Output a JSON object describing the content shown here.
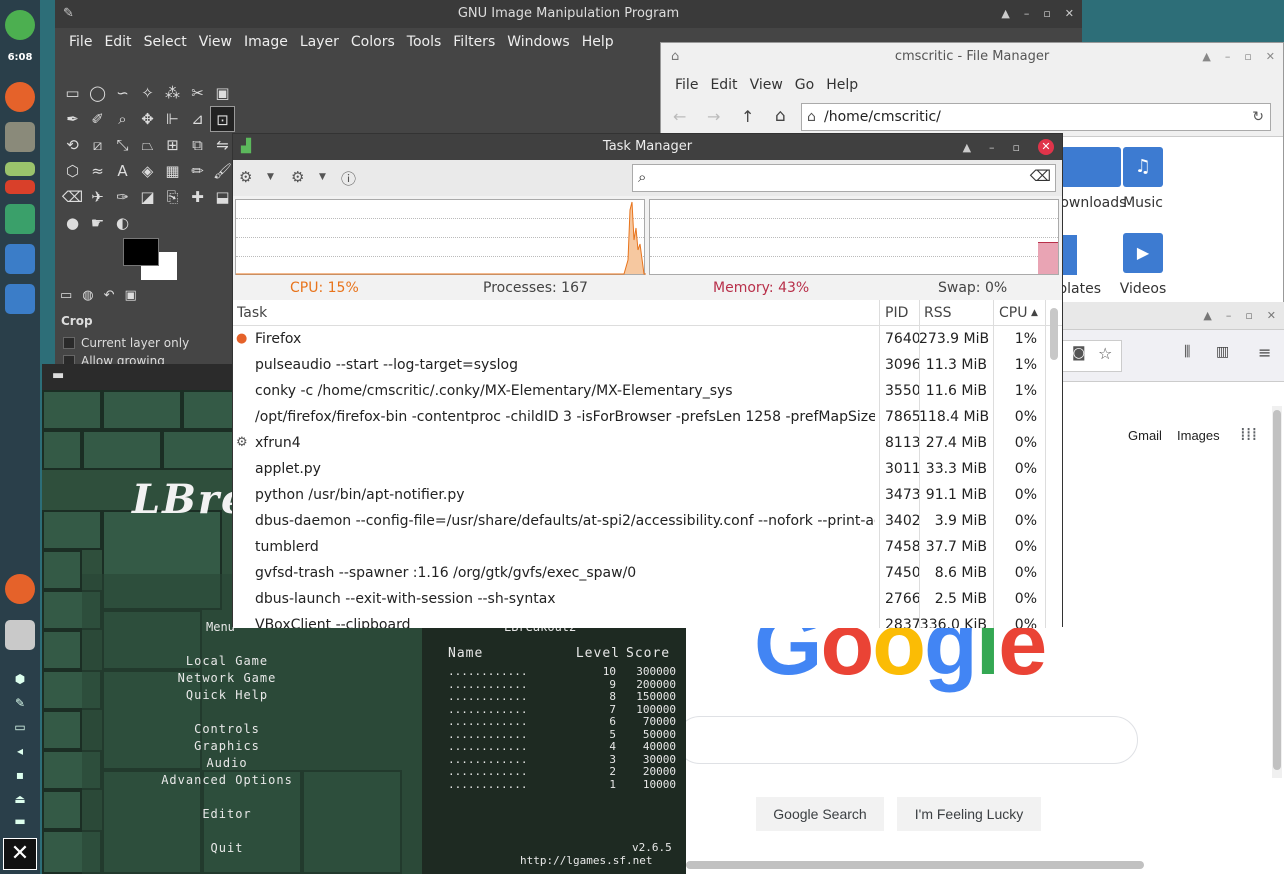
{
  "panel": {
    "time": "6:08",
    "icons": [
      "power-icon",
      "firefox-icon",
      "gimp-icon",
      "pen-icon",
      "lbreakout-icon",
      "taskmanager-icon",
      "home-folder-icon",
      "home-folder-icon",
      "firefox-icon",
      "files-icon"
    ],
    "tray": [
      "package-icon",
      "paperclip-icon",
      "display-icon",
      "volume-icon",
      "lock-icon",
      "eject-icon",
      "keyboard-icon"
    ]
  },
  "gimp": {
    "title": "GNU Image Manipulation Program",
    "menu": [
      "File",
      "Edit",
      "Select",
      "View",
      "Image",
      "Layer",
      "Colors",
      "Tools",
      "Filters",
      "Windows",
      "Help"
    ],
    "tool_options_title": "Crop",
    "current_layer_only": "Current layer only",
    "allow_growing": "Allow growing"
  },
  "lbreakout": {
    "logo": "LBreakout",
    "menu_title": "Menu",
    "menu": [
      "Local Game",
      "Network Game",
      "Quick Help",
      "",
      "Controls",
      "Graphics",
      "Audio",
      "Advanced Options",
      "",
      "Editor",
      "",
      "Quit"
    ],
    "highscore_title": "LBreakout2",
    "headers": [
      "Name",
      "Level",
      "Score"
    ],
    "scores": [
      [
        "............",
        "10",
        "300000"
      ],
      [
        "............",
        "9",
        "200000"
      ],
      [
        "............",
        "8",
        "150000"
      ],
      [
        "............",
        "7",
        "100000"
      ],
      [
        "............",
        "6",
        "70000"
      ],
      [
        "............",
        "5",
        "50000"
      ],
      [
        "............",
        "4",
        "40000"
      ],
      [
        "............",
        "3",
        "30000"
      ],
      [
        "............",
        "2",
        "20000"
      ],
      [
        "............",
        "1",
        "10000"
      ]
    ],
    "version": "v2.6.5",
    "url": "http://lgames.sf.net"
  },
  "filemanager": {
    "title": "cmscritic - File Manager",
    "menu": [
      "File",
      "Edit",
      "View",
      "Go",
      "Help"
    ],
    "path": "/home/cmscritic/",
    "folders": [
      "Downloads",
      "Music",
      "Templates",
      "Videos"
    ]
  },
  "firefox": {
    "links": [
      "Gmail",
      "Images"
    ],
    "search_button": "Google Search",
    "lucky_button": "I'm Feeling Lucky",
    "logo": "Google",
    "logo_colors": [
      "#4285F4",
      "#EA4335",
      "#FBBC05",
      "#4285F4",
      "#34A853",
      "#EA4335"
    ]
  },
  "taskmanager": {
    "title": "Task Manager",
    "search_value": "",
    "cpu_label": "CPU: 15%",
    "processes_label": "Processes: 167",
    "memory_label": "Memory: 43%",
    "swap_label": "Swap: 0%",
    "cpu_color": "#e8741c",
    "memory_color": "#b8304a",
    "columns": [
      "Task",
      "PID",
      "RSS",
      "CPU"
    ],
    "rows": [
      {
        "task": "Firefox",
        "pid": "7640",
        "rss": "273.9 MiB",
        "cpu": "1%",
        "icon": "firefox-icon"
      },
      {
        "task": "pulseaudio --start --log-target=syslog",
        "pid": "3096",
        "rss": "11.3 MiB",
        "cpu": "1%",
        "icon": ""
      },
      {
        "task": "conky -c /home/cmscritic/.conky/MX-Elementary/MX-Elementary_sys",
        "pid": "3550",
        "rss": "11.6 MiB",
        "cpu": "1%",
        "icon": ""
      },
      {
        "task": "/opt/firefox/firefox-bin -contentproc -childID 3 -isForBrowser -prefsLen 1258 -prefMapSize ...",
        "pid": "7865",
        "rss": "118.4 MiB",
        "cpu": "0%",
        "icon": ""
      },
      {
        "task": "xfrun4",
        "pid": "8113",
        "rss": "27.4 MiB",
        "cpu": "0%",
        "icon": "gear-icon"
      },
      {
        "task": "applet.py",
        "pid": "3011",
        "rss": "33.3 MiB",
        "cpu": "0%",
        "icon": ""
      },
      {
        "task": "python /usr/bin/apt-notifier.py",
        "pid": "3473",
        "rss": "91.1 MiB",
        "cpu": "0%",
        "icon": ""
      },
      {
        "task": "dbus-daemon --config-file=/usr/share/defaults/at-spi2/accessibility.conf --nofork --print-ad...",
        "pid": "3402",
        "rss": "3.9 MiB",
        "cpu": "0%",
        "icon": ""
      },
      {
        "task": "tumblerd",
        "pid": "7458",
        "rss": "37.7 MiB",
        "cpu": "0%",
        "icon": ""
      },
      {
        "task": "gvfsd-trash --spawner :1.16 /org/gtk/gvfs/exec_spaw/0",
        "pid": "7450",
        "rss": "8.6 MiB",
        "cpu": "0%",
        "icon": ""
      },
      {
        "task": "dbus-launch --exit-with-session --sh-syntax",
        "pid": "2766",
        "rss": "2.5 MiB",
        "cpu": "0%",
        "icon": ""
      },
      {
        "task": "VBoxClient --clipboard",
        "pid": "2837",
        "rss": "336.0 KiB",
        "cpu": "0%",
        "icon": ""
      }
    ]
  }
}
